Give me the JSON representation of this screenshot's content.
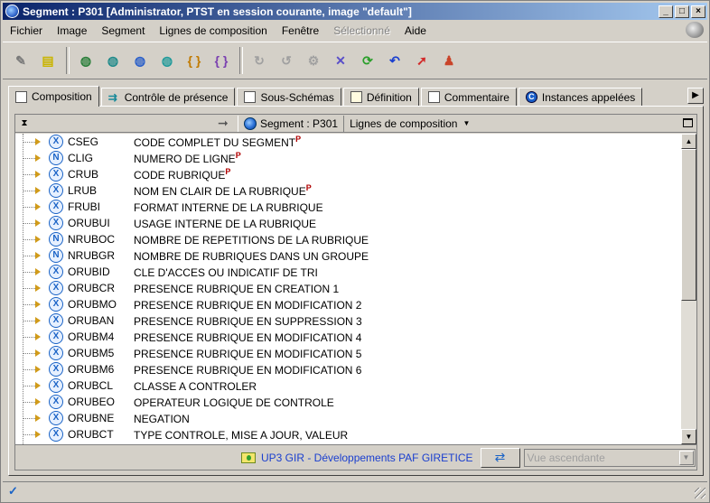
{
  "window": {
    "title": "Segment : P301 [Administrator, PTST en session courante, image \"default\"]",
    "controls": {
      "minimize": "_",
      "maximize": "□",
      "close": "×"
    }
  },
  "menu": [
    {
      "label": "Fichier",
      "disabled": false
    },
    {
      "label": "Image",
      "disabled": false
    },
    {
      "label": "Segment",
      "disabled": false
    },
    {
      "label": "Lignes de composition",
      "disabled": false
    },
    {
      "label": "Fenêtre",
      "disabled": false
    },
    {
      "label": "Sélectionné",
      "disabled": true
    },
    {
      "label": "Aide",
      "disabled": false
    }
  ],
  "toolbar": {
    "tools": [
      {
        "icon": "pen-icon",
        "glyph": "✎",
        "color": "#7a7a7a"
      },
      {
        "icon": "document-icon",
        "glyph": "▤",
        "color": "#c9b400"
      },
      {
        "icon": "globe-green-icon",
        "glyph": "◍",
        "color": "#2a7f3a"
      },
      {
        "icon": "globe-teal-icon",
        "glyph": "◍",
        "color": "#1f8a8a"
      },
      {
        "icon": "globe-list-icon",
        "glyph": "◍",
        "color": "#2a5fc9"
      },
      {
        "icon": "globe-link-icon",
        "glyph": "◍",
        "color": "#1f9a9a"
      },
      {
        "icon": "bracket-icon",
        "glyph": "{ }",
        "color": "#c17a00"
      },
      {
        "icon": "bracket-link-icon",
        "glyph": "{ }",
        "color": "#7a3fb0"
      },
      {
        "icon": "redo-disabled-icon",
        "glyph": "↻",
        "color": "#a0a0a0"
      },
      {
        "icon": "undo-disabled-icon",
        "glyph": "↺",
        "color": "#a0a0a0"
      },
      {
        "icon": "gear-disabled-icon",
        "glyph": "⚙",
        "color": "#a0a0a0"
      },
      {
        "icon": "delete-icon",
        "glyph": "✕",
        "color": "#5a4fc9"
      },
      {
        "icon": "refresh-icon",
        "glyph": "⟳",
        "color": "#2a9f2a"
      },
      {
        "icon": "undo-icon",
        "glyph": "↶",
        "color": "#1a3fcf"
      },
      {
        "icon": "arrow-red-icon",
        "glyph": "➚",
        "color": "#d22a2a"
      },
      {
        "icon": "user-icon",
        "glyph": "♟",
        "color": "#c9442a"
      }
    ]
  },
  "tabs": [
    {
      "label": "Composition",
      "active": true,
      "icon": "composition-icon"
    },
    {
      "label": "Contrôle de présence",
      "active": false,
      "icon": "presence-icon"
    },
    {
      "label": "Sous-Schémas",
      "active": false,
      "icon": "schema-icon"
    },
    {
      "label": "Définition",
      "active": false,
      "icon": "definition-icon"
    },
    {
      "label": "Commentaire",
      "active": false,
      "icon": "comment-icon"
    },
    {
      "label": "Instances appelées",
      "active": false,
      "icon": "instances-icon",
      "letter": "C"
    }
  ],
  "header": {
    "collapse_glyph": "⧗",
    "arrow_glyph": "➞",
    "crumb": "Segment : P301",
    "dropdown": "Lignes de composition",
    "dropdown_caret": "▼"
  },
  "rows": [
    {
      "type": "X",
      "code": "CSEG",
      "label": "CODE COMPLET DU SEGMENT",
      "flag": "P"
    },
    {
      "type": "N",
      "code": "CLIG",
      "label": "NUMERO DE LIGNE",
      "flag": "P"
    },
    {
      "type": "X",
      "code": "CRUB",
      "label": "CODE RUBRIQUE",
      "flag": "P"
    },
    {
      "type": "X",
      "code": "LRUB",
      "label": "NOM EN CLAIR DE LA RUBRIQUE",
      "flag": "P"
    },
    {
      "type": "X",
      "code": "FRUBI",
      "label": "FORMAT INTERNE DE LA RUBRIQUE",
      "flag": ""
    },
    {
      "type": "X",
      "code": "ORUBUI",
      "label": "USAGE INTERNE DE LA RUBRIQUE",
      "flag": ""
    },
    {
      "type": "N",
      "code": "NRUBOC",
      "label": "NOMBRE DE REPETITIONS DE LA RUBRIQUE",
      "flag": ""
    },
    {
      "type": "N",
      "code": "NRUBGR",
      "label": "NOMBRE DE RUBRIQUES DANS UN GROUPE",
      "flag": ""
    },
    {
      "type": "X",
      "code": "ORUBID",
      "label": "CLE D'ACCES OU INDICATIF DE TRI",
      "flag": ""
    },
    {
      "type": "X",
      "code": "ORUBCR",
      "label": "PRESENCE RUBRIQUE EN CREATION 1",
      "flag": ""
    },
    {
      "type": "X",
      "code": "ORUBMO",
      "label": "PRESENCE RUBRIQUE EN MODIFICATION 2",
      "flag": ""
    },
    {
      "type": "X",
      "code": "ORUBAN",
      "label": "PRESENCE RUBRIQUE EN SUPPRESSION 3",
      "flag": ""
    },
    {
      "type": "X",
      "code": "ORUBM4",
      "label": "PRESENCE RUBRIQUE EN MODIFICATION 4",
      "flag": ""
    },
    {
      "type": "X",
      "code": "ORUBM5",
      "label": "PRESENCE RUBRIQUE EN MODIFICATION 5",
      "flag": ""
    },
    {
      "type": "X",
      "code": "ORUBM6",
      "label": "PRESENCE RUBRIQUE EN MODIFICATION 6",
      "flag": ""
    },
    {
      "type": "X",
      "code": "ORUBCL",
      "label": "CLASSE A CONTROLER",
      "flag": ""
    },
    {
      "type": "X",
      "code": "ORUBEO",
      "label": "OPERATEUR LOGIQUE DE CONTROLE",
      "flag": ""
    },
    {
      "type": "X",
      "code": "ORUBNE",
      "label": "NEGATION",
      "flag": ""
    },
    {
      "type": "X",
      "code": "ORUBCT",
      "label": "TYPE CONTROLE, MISE A JOUR, VALEUR",
      "flag": ""
    }
  ],
  "footer": {
    "context": "UP3 GIR - Développements PAF GIRETICE",
    "swap_glyph": "⇄",
    "view_select": "Vue ascendante",
    "caret": "▼"
  },
  "status": {
    "check_glyph": "✓"
  },
  "scroll": {
    "up": "▲",
    "down": "▼"
  },
  "tab_scroll": "▶"
}
